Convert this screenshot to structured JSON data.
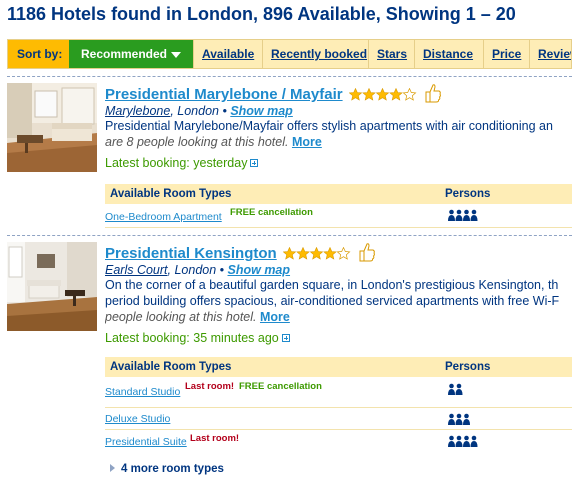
{
  "header": {
    "title": "1186 Hotels found in London, 896 Available, Showing 1 – 20"
  },
  "sortbar": {
    "label": "Sort by:",
    "active": "Recommended",
    "tabs": [
      "Available",
      "Recently booked",
      "Stars",
      "Distance",
      "Price",
      "Review"
    ]
  },
  "hotels": [
    {
      "name": "Presidential Marylebone / Mayfair",
      "stars": 4,
      "district": "Marylebone",
      "city": ", London • ",
      "show_map": "Show map",
      "desc_line1": "Presidential Marylebone/Mayfair offers stylish apartments with air conditioning an",
      "desc_line2": "are 8 people looking at this hotel.",
      "more": "More",
      "latest_booking": "Latest booking: yesterday",
      "rooms_header": "Available Room Types",
      "persons_header": "Persons",
      "rooms": [
        {
          "name": "One-Bedroom Apartment",
          "last": "",
          "free": "FREE cancellation",
          "persons": 4
        }
      ]
    },
    {
      "name": "Presidential Kensington",
      "stars": 4,
      "district": "Earls Court",
      "city": ", London • ",
      "show_map": "Show map",
      "desc_line1": "On the corner of a beautiful garden square, in London's prestigious Kensington, th",
      "desc_line2a": "period building offers spacious, air-conditioned serviced apartments with free Wi-F",
      "desc_line2": "people looking at this hotel.",
      "more": "More",
      "latest_booking": "Latest booking: 35 minutes ago",
      "rooms_header": "Available Room Types",
      "persons_header": "Persons",
      "rooms": [
        {
          "name": "Standard Studio",
          "last": "Last room!",
          "free": "FREE cancellation",
          "persons": 2
        },
        {
          "name": "Deluxe Studio",
          "last": "",
          "free": "",
          "persons": 3
        },
        {
          "name": "Presidential Suite",
          "last": "Last room!",
          "free": "",
          "persons": 4
        }
      ],
      "more_room_types": "4 more room types"
    }
  ],
  "colors": {
    "brand_blue": "#003580",
    "link_blue": "#1e8acc",
    "sort_yellow": "#febb02",
    "active_green": "#2a9c1f",
    "star_gold": "#febb02",
    "warn_red": "#b3001b"
  }
}
